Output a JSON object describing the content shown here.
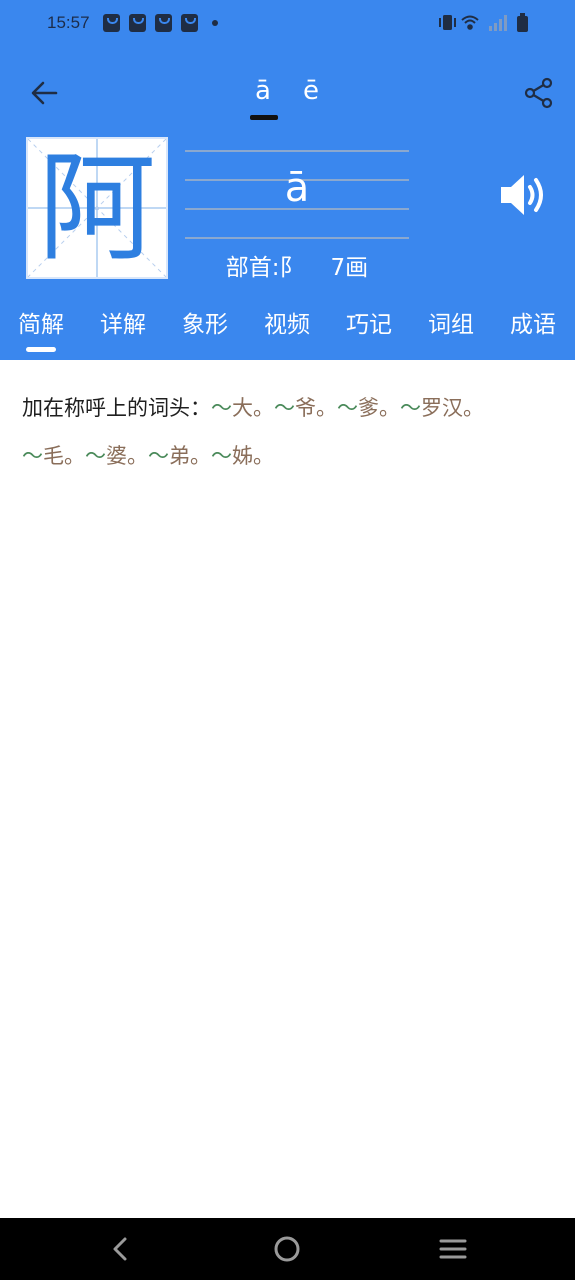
{
  "status_bar": {
    "time": "15:57",
    "notification_icons": [
      "shopping-bag-icon",
      "shopping-bag-icon",
      "shopping-bag-icon",
      "shopping-bag-icon"
    ],
    "system_icons": [
      "vibrate-icon",
      "wifi-icon",
      "signal-icon",
      "battery-icon"
    ]
  },
  "toolbar": {
    "pinyin_tabs": [
      {
        "label": "ā",
        "selected": true
      },
      {
        "label": "ē",
        "selected": false
      }
    ]
  },
  "character": {
    "glyph": "阿",
    "pinyin": "ā",
    "radical_label": "部首:阝",
    "strokes_label": "7画"
  },
  "tabs": [
    {
      "label": "简解",
      "selected": true
    },
    {
      "label": "详解",
      "selected": false
    },
    {
      "label": "象形",
      "selected": false
    },
    {
      "label": "视频",
      "selected": false
    },
    {
      "label": "巧记",
      "selected": false
    },
    {
      "label": "词组",
      "selected": false
    },
    {
      "label": "成语",
      "selected": false
    }
  ],
  "definition": {
    "intro": "加在称呼上的词头：",
    "examples": [
      "大",
      "爷",
      "爹",
      "罗汉",
      "毛",
      "婆",
      "弟",
      "姊"
    ],
    "tilde": "～",
    "separator": "。"
  },
  "colors": {
    "header_bg": "#3a87ee",
    "glyph": "#2e7fe0",
    "tilde": "#4a8a5a",
    "example_word": "#8a6e5a"
  }
}
